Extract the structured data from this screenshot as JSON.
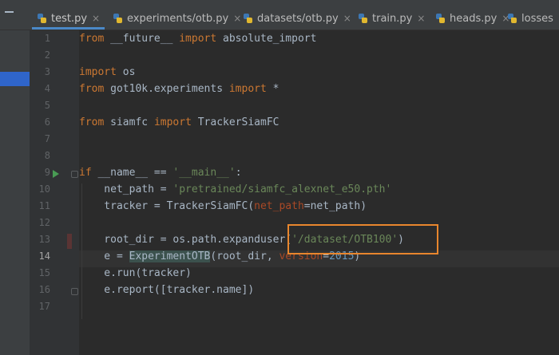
{
  "tabs": [
    {
      "label": "test.py",
      "active": true,
      "closable": true
    },
    {
      "label": "experiments/otb.py",
      "active": false,
      "closable": true
    },
    {
      "label": "datasets/otb.py",
      "active": false,
      "closable": true
    },
    {
      "label": "train.py",
      "active": false,
      "closable": true
    },
    {
      "label": "heads.py",
      "active": false,
      "closable": true
    },
    {
      "label": "losses",
      "active": false,
      "closable": false
    }
  ],
  "line_numbers": [
    "1",
    "2",
    "3",
    "4",
    "5",
    "6",
    "7",
    "8",
    "9",
    "10",
    "11",
    "12",
    "13",
    "14",
    "15",
    "16",
    "17"
  ],
  "current_line": "14",
  "code": {
    "l1": {
      "k1": "from",
      "t1": " __future__ ",
      "k2": "import",
      "t2": " absolute_import"
    },
    "l3": {
      "k1": "import",
      "t1": " os"
    },
    "l4": {
      "k1": "from",
      "t1": " got10k.experiments ",
      "k2": "import",
      "t2": " *"
    },
    "l6": {
      "k1": "from",
      "t1": " siamfc ",
      "k2": "import",
      "t2": " TrackerSiamFC"
    },
    "l9": {
      "k1": "if",
      "t1": " __name__ == ",
      "s1": "'__main__'",
      "t2": ":"
    },
    "l10": {
      "t1": "    net_path = ",
      "s1": "'pretrained/siamfc_alexnet_e50.pth'"
    },
    "l11": {
      "t1": "    tracker = TrackerSiamFC(",
      "p1": "net_path",
      "t2": "=net_path)"
    },
    "l13": {
      "t1": "    root_dir = os.path.expanduser(",
      "s1": "'/dataset/OTB100'",
      "t2": ")"
    },
    "l14": {
      "t1": "    e = ",
      "h1": "ExperimentOTB",
      "t2": "(root_dir, ",
      "p1": "version",
      "t3": "=",
      "n1": "2015",
      "t4": ")"
    },
    "l15": {
      "t1": "    e.run(tracker)"
    },
    "l16": {
      "t1": "    e.report([tracker.name])"
    }
  },
  "colors": {
    "keyword": "#cc7832",
    "string": "#6a8759",
    "number": "#6897bb",
    "parameter": "#aa4926",
    "highlight_box": "#e8862d",
    "active_tab_underline": "#4a88c7"
  }
}
